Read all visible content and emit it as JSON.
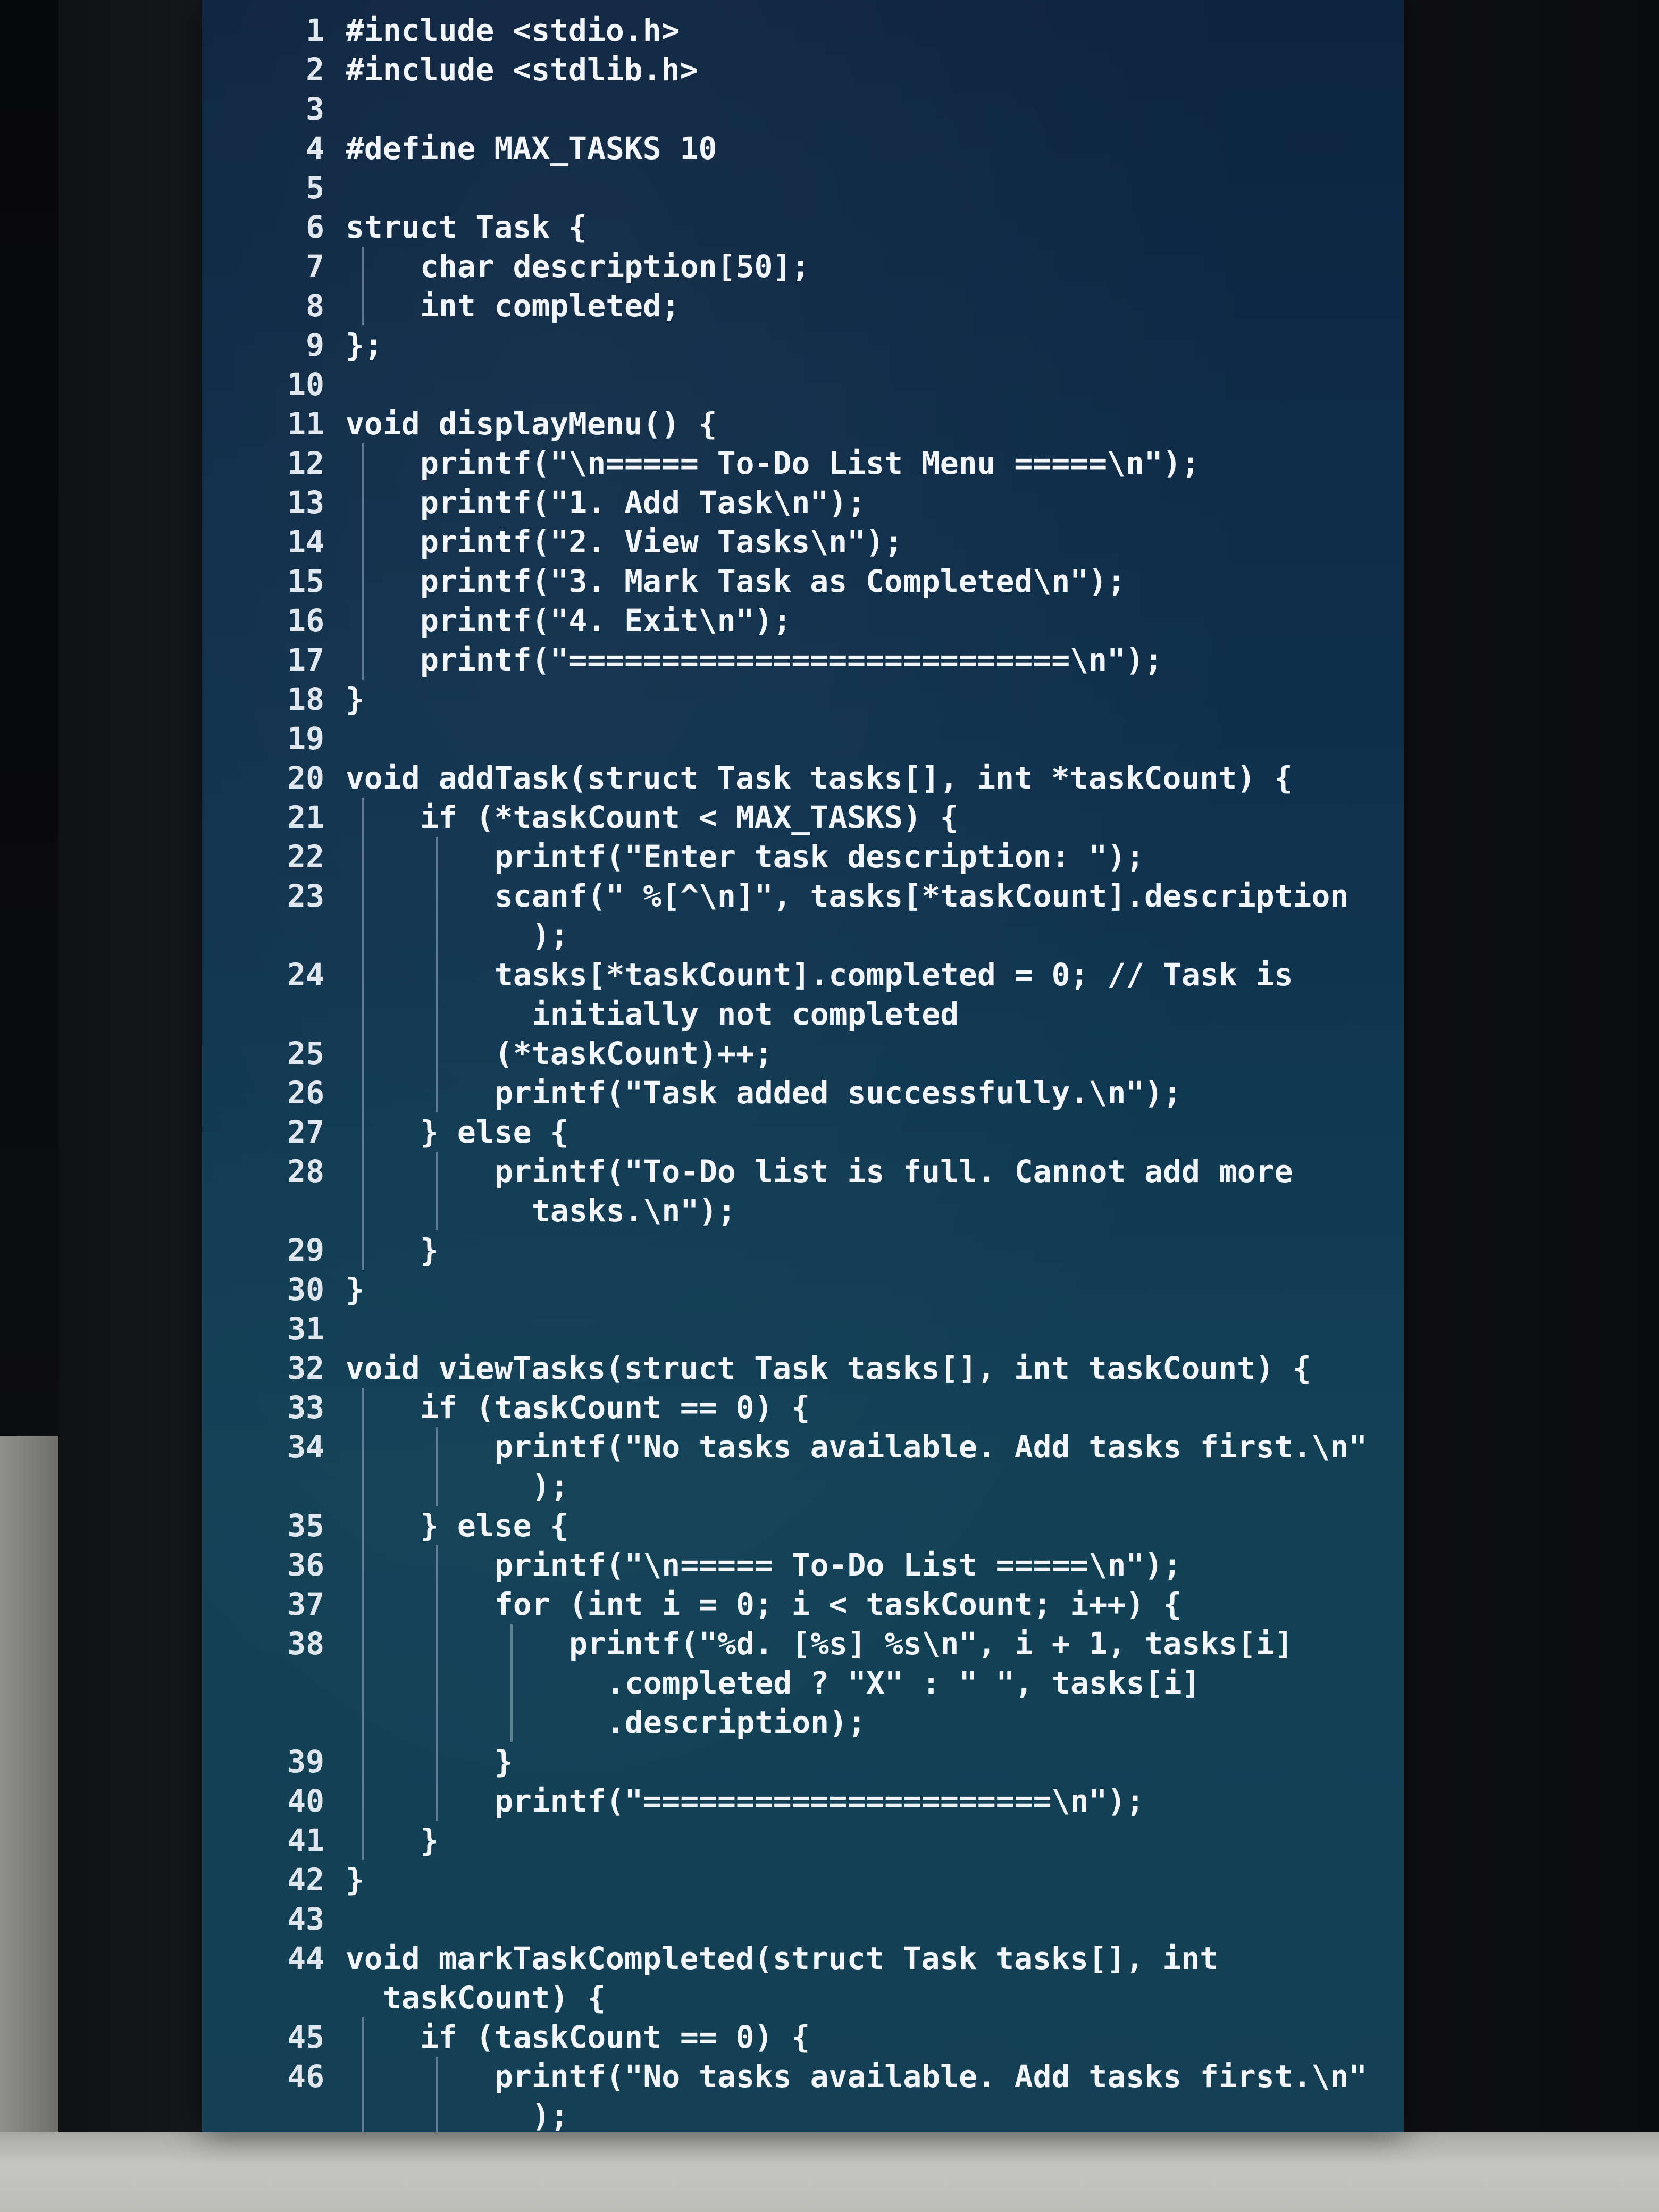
{
  "editor": {
    "lines": [
      {
        "n": "1",
        "indent": 0,
        "text": "#include <stdio.h>"
      },
      {
        "n": "2",
        "indent": 0,
        "text": "#include <stdlib.h>"
      },
      {
        "n": "3",
        "indent": 0,
        "text": ""
      },
      {
        "n": "4",
        "indent": 0,
        "text": "#define MAX_TASKS 10"
      },
      {
        "n": "5",
        "indent": 0,
        "text": ""
      },
      {
        "n": "6",
        "indent": 0,
        "text": "struct Task {"
      },
      {
        "n": "7",
        "indent": 1,
        "text": "char description[50];"
      },
      {
        "n": "8",
        "indent": 1,
        "text": "int completed;"
      },
      {
        "n": "9",
        "indent": 0,
        "text": "};"
      },
      {
        "n": "10",
        "indent": 0,
        "text": ""
      },
      {
        "n": "11",
        "indent": 0,
        "text": "void displayMenu() {"
      },
      {
        "n": "12",
        "indent": 1,
        "text": "printf(\"\\n===== To-Do List Menu =====\\n\");"
      },
      {
        "n": "13",
        "indent": 1,
        "text": "printf(\"1. Add Task\\n\");"
      },
      {
        "n": "14",
        "indent": 1,
        "text": "printf(\"2. View Tasks\\n\");"
      },
      {
        "n": "15",
        "indent": 1,
        "text": "printf(\"3. Mark Task as Completed\\n\");"
      },
      {
        "n": "16",
        "indent": 1,
        "text": "printf(\"4. Exit\\n\");"
      },
      {
        "n": "17",
        "indent": 1,
        "text": "printf(\"===========================\\n\");"
      },
      {
        "n": "18",
        "indent": 0,
        "text": "}"
      },
      {
        "n": "19",
        "indent": 0,
        "text": ""
      },
      {
        "n": "20",
        "indent": 0,
        "text": "void addTask(struct Task tasks[], int *taskCount) {"
      },
      {
        "n": "21",
        "indent": 1,
        "text": "if (*taskCount < MAX_TASKS) {"
      },
      {
        "n": "22",
        "indent": 2,
        "text": "printf(\"Enter task description: \");"
      },
      {
        "n": "23",
        "indent": 2,
        "text": "scanf(\" %[^\\n]\", tasks[*taskCount].description"
      },
      {
        "n": "",
        "indent": 2,
        "cont": true,
        "text": ");"
      },
      {
        "n": "24",
        "indent": 2,
        "text": "tasks[*taskCount].completed = 0; // Task is"
      },
      {
        "n": "",
        "indent": 2,
        "cont": true,
        "text": "initially not completed"
      },
      {
        "n": "25",
        "indent": 2,
        "text": "(*taskCount)++;"
      },
      {
        "n": "26",
        "indent": 2,
        "text": "printf(\"Task added successfully.\\n\");"
      },
      {
        "n": "27",
        "indent": 1,
        "text": "} else {"
      },
      {
        "n": "28",
        "indent": 2,
        "text": "printf(\"To-Do list is full. Cannot add more"
      },
      {
        "n": "",
        "indent": 2,
        "cont": true,
        "text": "tasks.\\n\");"
      },
      {
        "n": "29",
        "indent": 1,
        "text": "}"
      },
      {
        "n": "30",
        "indent": 0,
        "text": "}"
      },
      {
        "n": "31",
        "indent": 0,
        "text": ""
      },
      {
        "n": "32",
        "indent": 0,
        "text": "void viewTasks(struct Task tasks[], int taskCount) {"
      },
      {
        "n": "33",
        "indent": 1,
        "text": "if (taskCount == 0) {"
      },
      {
        "n": "34",
        "indent": 2,
        "text": "printf(\"No tasks available. Add tasks first.\\n\""
      },
      {
        "n": "",
        "indent": 2,
        "cont": true,
        "text": ");"
      },
      {
        "n": "35",
        "indent": 1,
        "text": "} else {"
      },
      {
        "n": "36",
        "indent": 2,
        "text": "printf(\"\\n===== To-Do List =====\\n\");"
      },
      {
        "n": "37",
        "indent": 2,
        "text": "for (int i = 0; i < taskCount; i++) {"
      },
      {
        "n": "38",
        "indent": 3,
        "text": "printf(\"%d. [%s] %s\\n\", i + 1, tasks[i]"
      },
      {
        "n": "",
        "indent": 3,
        "cont": true,
        "text": ".completed ? \"X\" : \" \", tasks[i]"
      },
      {
        "n": "",
        "indent": 3,
        "cont": true,
        "text": ".description);"
      },
      {
        "n": "39",
        "indent": 2,
        "text": "}"
      },
      {
        "n": "40",
        "indent": 2,
        "text": "printf(\"======================\\n\");"
      },
      {
        "n": "41",
        "indent": 1,
        "text": "}"
      },
      {
        "n": "42",
        "indent": 0,
        "text": "}"
      },
      {
        "n": "43",
        "indent": 0,
        "text": ""
      },
      {
        "n": "44",
        "indent": 0,
        "text": "void markTaskCompleted(struct Task tasks[], int"
      },
      {
        "n": "",
        "indent": 0,
        "cont": true,
        "text": "taskCount) {"
      },
      {
        "n": "45",
        "indent": 1,
        "text": "if (taskCount == 0) {"
      },
      {
        "n": "46",
        "indent": 2,
        "text": "printf(\"No tasks available. Add tasks first.\\n\""
      },
      {
        "n": "",
        "indent": 2,
        "cont": true,
        "text": ");"
      }
    ]
  }
}
